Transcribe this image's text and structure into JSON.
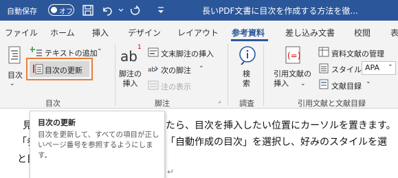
{
  "titlebar": {
    "autosave_label": "自動保存",
    "autosave_state": "オフ",
    "doc_title": "長いPDF文書に目次を作成する方法を徹..."
  },
  "tabs": [
    "ファイル",
    "ホーム",
    "挿入",
    "デザイン",
    "レイアウト",
    "参考資料",
    "差し込み文書",
    "校閲",
    "表"
  ],
  "active_tab": "参考資料",
  "ribbon": {
    "toc_group": {
      "toc_label": "目次",
      "add_text": "テキストの追加",
      "update_toc": "目次の更新",
      "group_label": "目次"
    },
    "footnote_group": {
      "insert_footnote": "脚注の\n挿入",
      "insert_endnote": "文末脚注の挿入",
      "next_footnote": "次の脚注",
      "show_notes": "注の表示",
      "group_label": "脚注",
      "ab_text": "ab"
    },
    "research_group": {
      "search": "検\n索",
      "group_label": "調査"
    },
    "citations_group": {
      "insert_citation": "引用文献の\n挿入",
      "manage_sources": "資料文献の管理",
      "style_label": "スタイル:",
      "style_value": "APA",
      "bibliography": "文献目録",
      "group_label": "引用文献と文献目録"
    }
  },
  "tooltip": {
    "title": "目次の更新",
    "body": "目次を更新して、すべての項目が正しいページ番号を参照するようにします。"
  },
  "document": {
    "line1_start": "見",
    "line1_rest": "たら、目次を挿入したい位置にカーソルを置きます。",
    "line2_start": "「参",
    "line2_rest": "「自動作成の目次」を選択し、好みのスタイルを選",
    "line3_start": "と目",
    "para_mark": "↵"
  },
  "colors": {
    "title_bar": "#2b579a",
    "highlight": "#ed7d31",
    "ribbon_bg": "#f3f3f3"
  }
}
